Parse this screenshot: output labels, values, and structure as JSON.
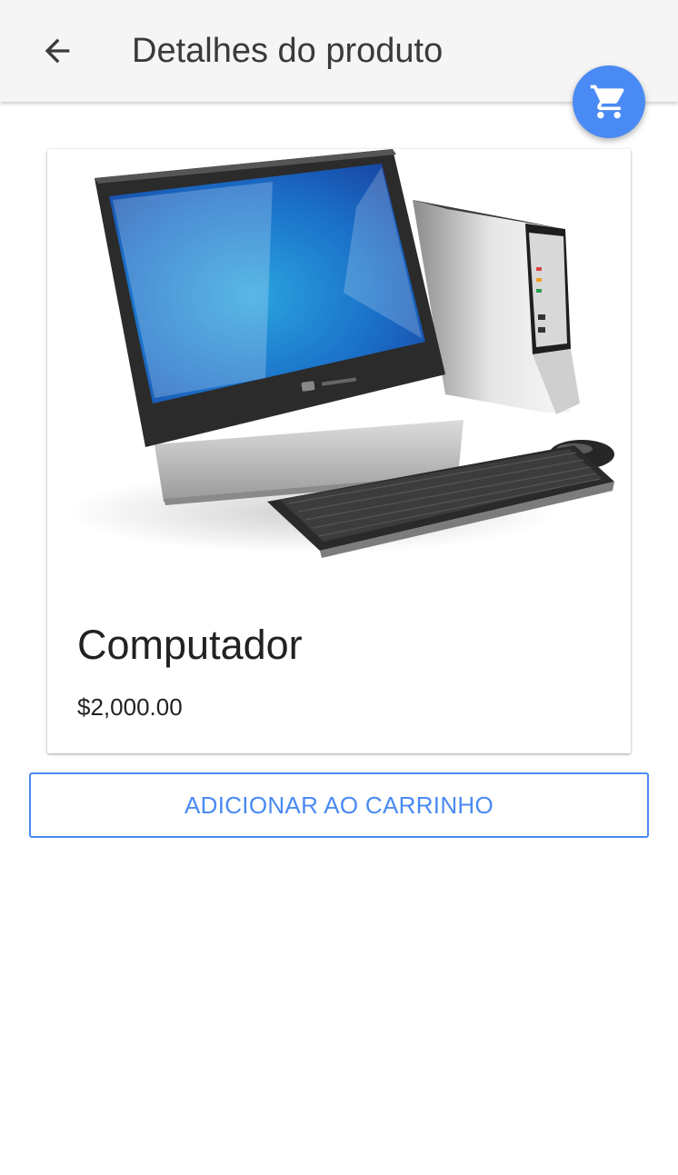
{
  "app_bar": {
    "title": "Detalhes do produto",
    "back_icon": "arrow-back-icon"
  },
  "fab": {
    "icon": "shopping-cart-icon",
    "color": "#4a8af4"
  },
  "product": {
    "name": "Computador",
    "price": "$2,000.00",
    "image_subject": "desktop-computer-with-monitor-tower-keyboard-mouse"
  },
  "actions": {
    "add_to_cart_label": "ADICIONAR AO CARRINHO"
  },
  "colors": {
    "accent": "#4a8af4",
    "app_bar_bg": "#f5f5f5",
    "text_primary": "#222222"
  }
}
